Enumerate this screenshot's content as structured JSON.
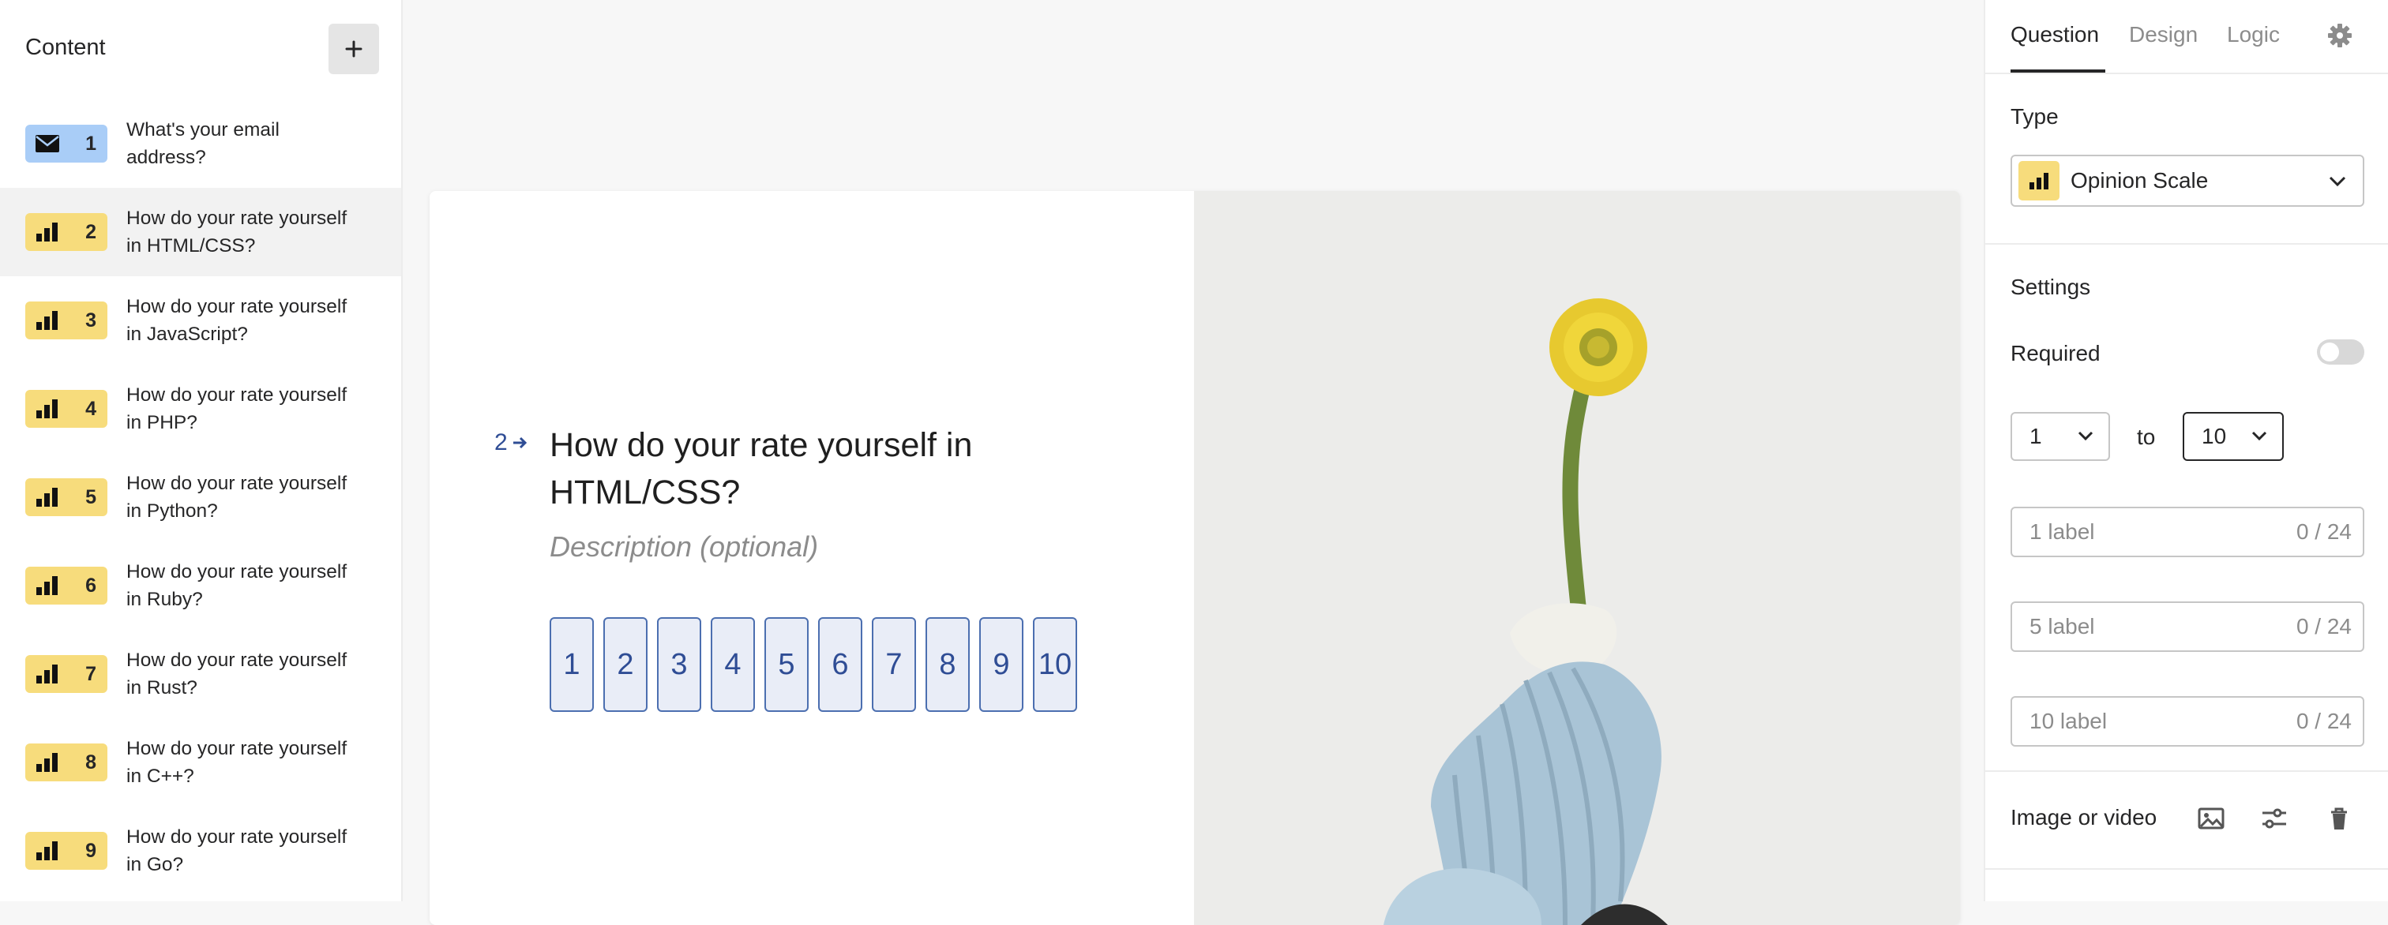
{
  "sidebar": {
    "title": "Content",
    "add_label": "+",
    "items": [
      {
        "num": "1",
        "text": "What's your email address?",
        "icon": "envelope-icon",
        "color": "blue"
      },
      {
        "num": "2",
        "text": "How do your rate yourself in HTML/CSS?",
        "icon": "bar-chart-icon",
        "color": "yellow"
      },
      {
        "num": "3",
        "text": "How do your rate yourself in JavaScript?",
        "icon": "bar-chart-icon",
        "color": "yellow"
      },
      {
        "num": "4",
        "text": "How do your rate yourself in PHP?",
        "icon": "bar-chart-icon",
        "color": "yellow"
      },
      {
        "num": "5",
        "text": "How do your rate yourself in Python?",
        "icon": "bar-chart-icon",
        "color": "yellow"
      },
      {
        "num": "6",
        "text": "How do your rate yourself in Ruby?",
        "icon": "bar-chart-icon",
        "color": "yellow"
      },
      {
        "num": "7",
        "text": "How do your rate yourself in Rust?",
        "icon": "bar-chart-icon",
        "color": "yellow"
      },
      {
        "num": "8",
        "text": "How do your rate yourself in C++?",
        "icon": "bar-chart-icon",
        "color": "yellow"
      },
      {
        "num": "9",
        "text": "How do your rate yourself in Go?",
        "icon": "bar-chart-icon",
        "color": "yellow"
      }
    ]
  },
  "question": {
    "number": "2",
    "title": "How do your rate yourself in HTML/CSS?",
    "description_placeholder": "Description (optional)",
    "scale": [
      "1",
      "2",
      "3",
      "4",
      "5",
      "6",
      "7",
      "8",
      "9",
      "10"
    ]
  },
  "panel": {
    "tabs": [
      "Question",
      "Design",
      "Logic"
    ],
    "type_label": "Type",
    "type_value": "Opinion Scale",
    "settings_label": "Settings",
    "required_label": "Required",
    "required_on": false,
    "range_from": "1",
    "range_to_text": "to",
    "range_to": "10",
    "label_fields": [
      {
        "placeholder": "1 label",
        "count": "0 / 24"
      },
      {
        "placeholder": "5 label",
        "count": "0 / 24"
      },
      {
        "placeholder": "10 label",
        "count": "0 / 24"
      }
    ],
    "media_label": "Image or video"
  },
  "colors": {
    "accent_blue": "#2f4d95",
    "badge_yellow": "#f7dc7c",
    "badge_blue": "#a9cdf7"
  }
}
